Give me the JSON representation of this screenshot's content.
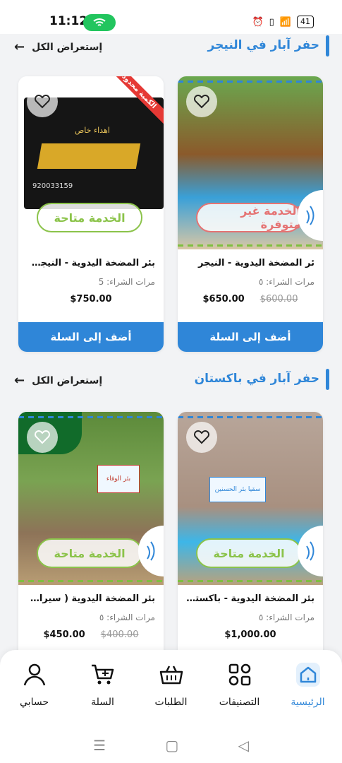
{
  "status_bar": {
    "time": "11:12",
    "battery": "41"
  },
  "sections": [
    {
      "title": "حفر آبار في النيجر",
      "view_all": "إستعراض الكل",
      "cards": [
        {
          "name": "ئر المضخة اليدوية - النيجر",
          "buys": "مرات الشراء: ٥",
          "price": "$650.00",
          "old_price": "$600.00",
          "status": "الخدمة غير متوفرة",
          "add": "أضف إلى السلة"
        },
        {
          "name": "بئر المضخة اليدوية - النيجر مع...",
          "buys": "مرات الشراء: 5",
          "price": "$750.00",
          "old_price": "",
          "status": "الخدمة متاحة",
          "add": "أضف إلى السلة",
          "gift_line1": "اهداء خاص",
          "phone": "920033159",
          "ribbon": "الكمية محدودة"
        }
      ]
    },
    {
      "title": "حفر آبار في باكستان",
      "view_all": "إستعراض الكل",
      "cards": [
        {
          "name": "بئر المضخة اليدوية - باكستان",
          "buys": "مرات الشراء: ٥",
          "price": "$1,000.00",
          "old_price": "",
          "status": "الخدمة متاحة",
          "banner": "سقيا بئر الحسنين"
        },
        {
          "name": "بئر المضخة اليدوية ( سيراميك ...",
          "buys": "مرات الشراء: ٥",
          "price": "$450.00",
          "old_price": "$400.00",
          "status": "الخدمة متاحة",
          "banner": "بئر الوفاء"
        }
      ]
    }
  ],
  "nav": {
    "home": "الرئيسية",
    "categories": "التصنيفات",
    "orders": "الطلبات",
    "cart": "السلة",
    "account": "حسابي"
  },
  "colors": {
    "accent": "#2f86d8",
    "available": "#8bc34a",
    "unavailable": "#e57373"
  }
}
